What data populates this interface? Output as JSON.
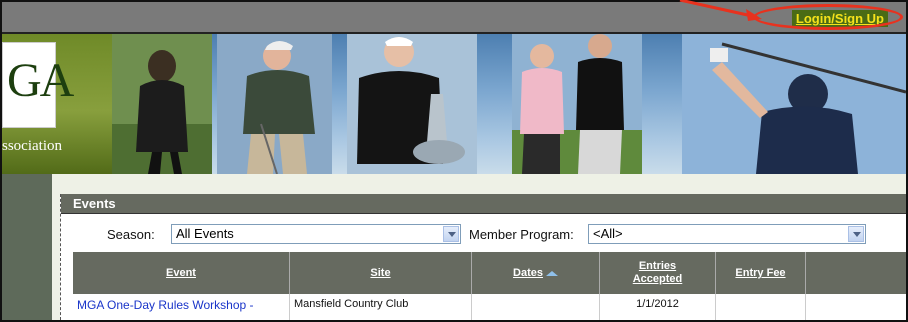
{
  "header": {
    "login_label": "Login/Sign Up"
  },
  "banner": {
    "logo_letters": "GA",
    "logo_subtitle": "ssociation"
  },
  "events": {
    "title": "Events",
    "filters": {
      "season_label": "Season:",
      "season_value": "All Events",
      "member_program_label": "Member Program:",
      "member_program_value": "<All>"
    },
    "columns": [
      {
        "label": "Event"
      },
      {
        "label": "Site"
      },
      {
        "label": "Dates"
      },
      {
        "label": "Entries Accepted"
      },
      {
        "label": "Entry Fee"
      },
      {
        "label": ""
      }
    ],
    "rows": [
      {
        "event": "MGA One-Day Rules Workshop -",
        "site": "Mansfield Country Club",
        "dates": "",
        "entries": "1/1/2012",
        "fee": ""
      }
    ]
  },
  "colors": {
    "topbar": "#7a7a7a",
    "login_text": "#f4e21b",
    "annotation": "#e8321e",
    "header_bar": "#666a60",
    "link": "#1a35c9"
  }
}
